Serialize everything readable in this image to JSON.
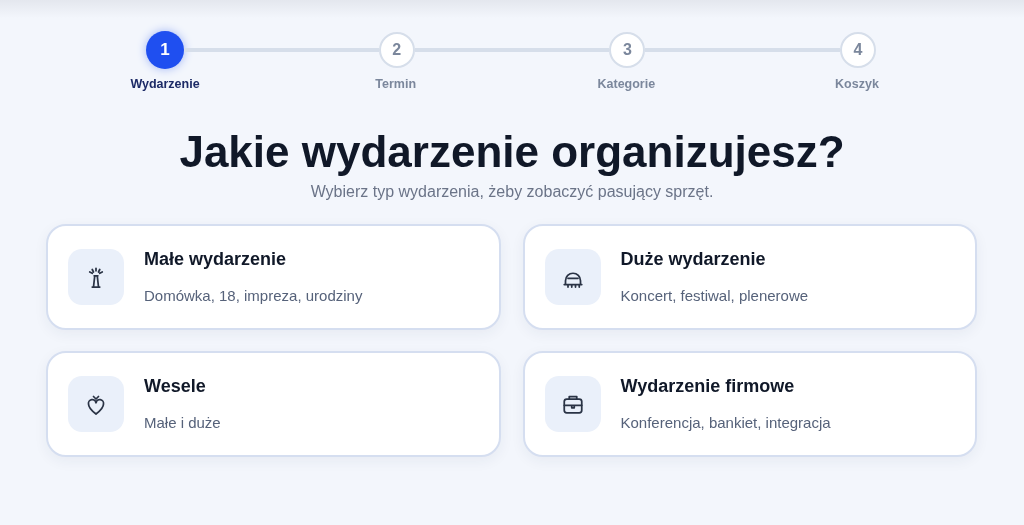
{
  "steps": [
    {
      "number": "1",
      "label": "Wydarzenie",
      "selected": true
    },
    {
      "number": "2",
      "label": "Termin",
      "selected": false
    },
    {
      "number": "3",
      "label": "Kategorie",
      "selected": false
    },
    {
      "number": "4",
      "label": "Koszyk",
      "selected": false
    }
  ],
  "heading": "Jakie wydarzenie organizujesz?",
  "subheading": "Wybierz typ wydarzenia, żeby zobaczyć pasujący sprzęt.",
  "options": [
    {
      "title": "Małe wydarzenie",
      "description": "Domówka, 18, impreza, urodziny"
    },
    {
      "title": "Duże wydarzenie",
      "description": "Koncert, festiwal, plenerowe"
    },
    {
      "title": "Wesele",
      "description": "Małe i duże"
    },
    {
      "title": "Wydarzenie firmowe",
      "description": "Konferencja, bankiet, integracja"
    }
  ]
}
